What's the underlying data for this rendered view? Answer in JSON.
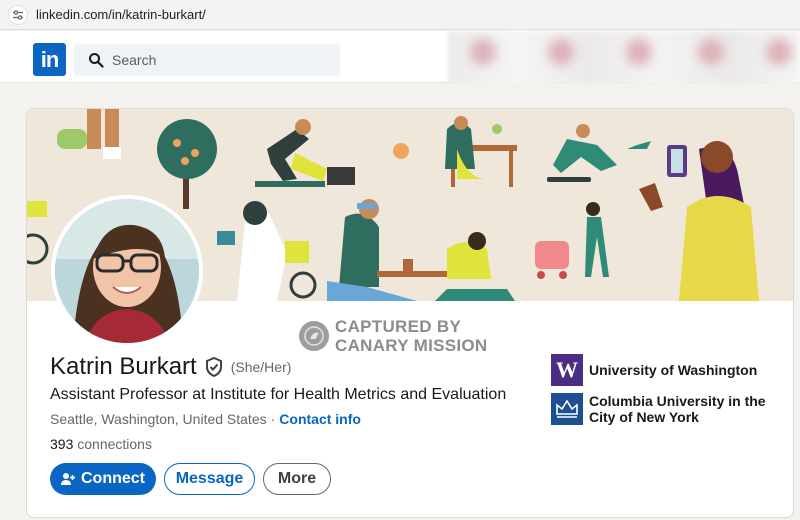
{
  "browser": {
    "url": "linkedin.com/in/katrin-burkart/"
  },
  "nav": {
    "logo_text": "in",
    "search_placeholder": "Search"
  },
  "watermark": {
    "line1": "CAPTURED BY",
    "line2": "CANARY MISSION"
  },
  "profile": {
    "name": "Katrin Burkart",
    "pronouns": "(She/Her)",
    "headline": "Assistant Professor at Institute for Health Metrics and Evaluation",
    "location": "Seattle, Washington, United States",
    "separator": "·",
    "contact_label": "Contact info",
    "connections_count": "393",
    "connections_label": "connections"
  },
  "actions": {
    "connect": "Connect",
    "message": "Message",
    "more": "More"
  },
  "education": [
    {
      "logo_text": "W",
      "name": "University of Washington"
    },
    {
      "name": "Columbia University in the City of New York"
    }
  ],
  "colors": {
    "linkedin_blue": "#0a66c2",
    "uw_purple": "#4b2e83",
    "columbia_blue": "#1d4f91",
    "banner_bg": "#efe8da"
  },
  "icons": {
    "site_controls": "tune-icon",
    "search": "search-icon",
    "verified": "shield-check-icon",
    "connect": "add-person-icon",
    "watermark": "canary-seal-icon"
  }
}
